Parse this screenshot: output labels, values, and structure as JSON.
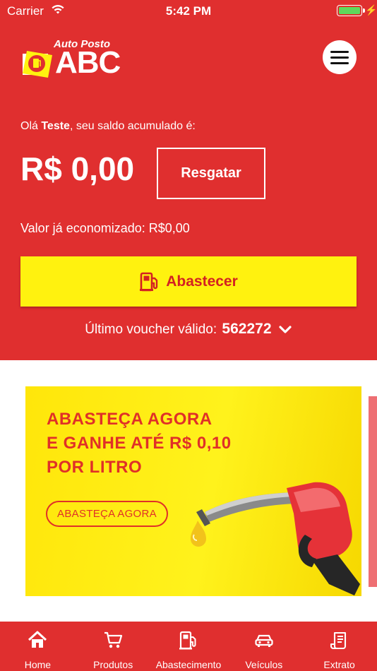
{
  "status_bar": {
    "carrier": "Carrier",
    "time": "5:42 PM"
  },
  "brand": {
    "tagline": "Auto Posto",
    "name": "ABC",
    "accent": "#e02f2f",
    "yellow": "#fff20f"
  },
  "header": {
    "menu_icon": "hamburger-icon"
  },
  "account": {
    "greeting_prefix": "Olá ",
    "user_name": "Teste",
    "greeting_suffix": ", seu saldo acumulado é:",
    "balance": "R$ 0,00",
    "redeem_label": "Resgatar",
    "saved_text": "Valor já economizado: R$0,00"
  },
  "refuel": {
    "label": "Abastecer",
    "icon": "fuel-pump-icon"
  },
  "voucher": {
    "label": "Último voucher válido:",
    "code": "562272",
    "icon": "chevron-down-icon"
  },
  "banner": {
    "line1": "ABASTEÇA AGORA",
    "line2": "E GANHE ATÉ R$ 0,10",
    "line3": "POR LITRO",
    "cta_label": "ABASTEÇA AGORA"
  },
  "tabs": [
    {
      "label": "Home",
      "icon": "home-icon"
    },
    {
      "label": "Produtos",
      "icon": "cart-icon"
    },
    {
      "label": "Abastecimento",
      "icon": "fuel-pump-icon"
    },
    {
      "label": "Veículos",
      "icon": "car-icon"
    },
    {
      "label": "Extrato",
      "icon": "receipt-icon"
    }
  ]
}
